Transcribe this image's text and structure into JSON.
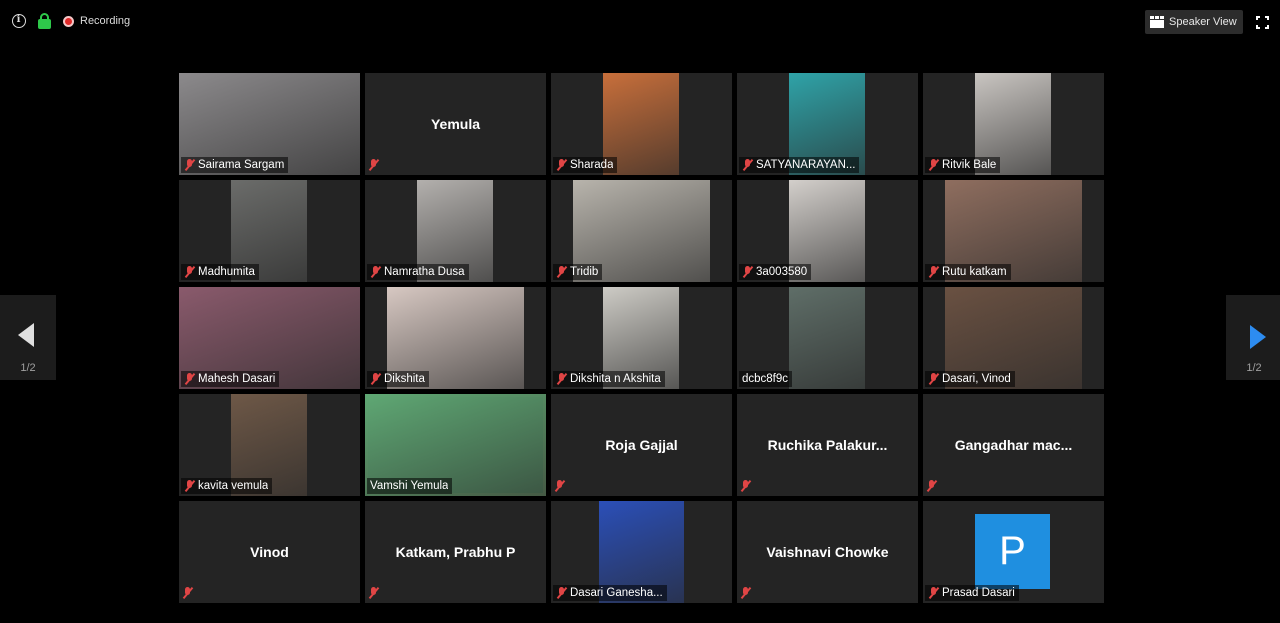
{
  "topbar": {
    "recording_label": "Recording",
    "speaker_view_label": "Speaker View"
  },
  "pagination": {
    "left": "1/2",
    "right": "1/2"
  },
  "participants": [
    {
      "name": "Sairama Sargam",
      "video": true,
      "bg": "#8c8a8c"
    },
    {
      "name": "Yemula",
      "video": false
    },
    {
      "name": "Sharada",
      "video": true,
      "bg": "#c86f3b"
    },
    {
      "name": "SATYANARAYAN...",
      "video": true,
      "bg": "#2fa3a8"
    },
    {
      "name": "Ritvik Bale",
      "video": true,
      "bg": "#c9c5c1"
    },
    {
      "name": "Madhumita",
      "video": true,
      "bg": "#6b6c6a"
    },
    {
      "name": "Namratha Dusa",
      "video": true,
      "bg": "#b3b0ad"
    },
    {
      "name": "Tridib",
      "video": true,
      "bg": "#b8b4ac"
    },
    {
      "name": "3a003580",
      "video": true,
      "bg": "#d3cfcb"
    },
    {
      "name": "Rutu katkam",
      "video": true,
      "bg": "#8f6e5f"
    },
    {
      "name": "Mahesh Dasari",
      "video": true,
      "bg": "#8a5a6c"
    },
    {
      "name": "Dikshita",
      "video": true,
      "bg": "#d7c8c2"
    },
    {
      "name": "Dikshita n Akshita",
      "video": true,
      "bg": "#cdcbc5"
    },
    {
      "name": "dcbc8f9c",
      "video": true,
      "bg": "#5f6e68"
    },
    {
      "name": "Dasari, Vinod",
      "video": true,
      "bg": "#6a5142"
    },
    {
      "name": "kavita vemula",
      "video": true,
      "bg": "#6e5847"
    },
    {
      "name": "Vamshi Yemula",
      "video": true,
      "bg": "#5fa874",
      "active": true
    },
    {
      "name": "Roja Gajjal",
      "video": false
    },
    {
      "name": "Ruchika Palakur...",
      "video": false
    },
    {
      "name": "Gangadhar mac...",
      "video": false
    },
    {
      "name": "Vinod",
      "video": false
    },
    {
      "name": "Katkam, Prabhu P",
      "video": false
    },
    {
      "name": "Dasari Ganesha...",
      "video": true,
      "bg": "#2b4fb8"
    },
    {
      "name": "Vaishnavi Chowke",
      "video": false
    },
    {
      "name": "Prasad Dasari",
      "video": false,
      "avatar_letter": "P",
      "avatar_color": "#1f8fe0"
    }
  ]
}
